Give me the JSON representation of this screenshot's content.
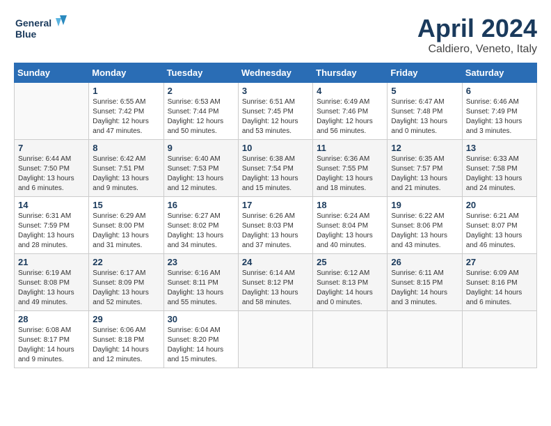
{
  "header": {
    "logo_line1": "General",
    "logo_line2": "Blue",
    "title": "April 2024",
    "location": "Caldiero, Veneto, Italy"
  },
  "weekdays": [
    "Sunday",
    "Monday",
    "Tuesday",
    "Wednesday",
    "Thursday",
    "Friday",
    "Saturday"
  ],
  "weeks": [
    [
      {
        "day": "",
        "sunrise": "",
        "sunset": "",
        "daylight": ""
      },
      {
        "day": "1",
        "sunrise": "6:55 AM",
        "sunset": "7:42 PM",
        "daylight": "12 hours and 47 minutes."
      },
      {
        "day": "2",
        "sunrise": "6:53 AM",
        "sunset": "7:44 PM",
        "daylight": "12 hours and 50 minutes."
      },
      {
        "day": "3",
        "sunrise": "6:51 AM",
        "sunset": "7:45 PM",
        "daylight": "12 hours and 53 minutes."
      },
      {
        "day": "4",
        "sunrise": "6:49 AM",
        "sunset": "7:46 PM",
        "daylight": "12 hours and 56 minutes."
      },
      {
        "day": "5",
        "sunrise": "6:47 AM",
        "sunset": "7:48 PM",
        "daylight": "13 hours and 0 minutes."
      },
      {
        "day": "6",
        "sunrise": "6:46 AM",
        "sunset": "7:49 PM",
        "daylight": "13 hours and 3 minutes."
      }
    ],
    [
      {
        "day": "7",
        "sunrise": "6:44 AM",
        "sunset": "7:50 PM",
        "daylight": "13 hours and 6 minutes."
      },
      {
        "day": "8",
        "sunrise": "6:42 AM",
        "sunset": "7:51 PM",
        "daylight": "13 hours and 9 minutes."
      },
      {
        "day": "9",
        "sunrise": "6:40 AM",
        "sunset": "7:53 PM",
        "daylight": "13 hours and 12 minutes."
      },
      {
        "day": "10",
        "sunrise": "6:38 AM",
        "sunset": "7:54 PM",
        "daylight": "13 hours and 15 minutes."
      },
      {
        "day": "11",
        "sunrise": "6:36 AM",
        "sunset": "7:55 PM",
        "daylight": "13 hours and 18 minutes."
      },
      {
        "day": "12",
        "sunrise": "6:35 AM",
        "sunset": "7:57 PM",
        "daylight": "13 hours and 21 minutes."
      },
      {
        "day": "13",
        "sunrise": "6:33 AM",
        "sunset": "7:58 PM",
        "daylight": "13 hours and 24 minutes."
      }
    ],
    [
      {
        "day": "14",
        "sunrise": "6:31 AM",
        "sunset": "7:59 PM",
        "daylight": "13 hours and 28 minutes."
      },
      {
        "day": "15",
        "sunrise": "6:29 AM",
        "sunset": "8:00 PM",
        "daylight": "13 hours and 31 minutes."
      },
      {
        "day": "16",
        "sunrise": "6:27 AM",
        "sunset": "8:02 PM",
        "daylight": "13 hours and 34 minutes."
      },
      {
        "day": "17",
        "sunrise": "6:26 AM",
        "sunset": "8:03 PM",
        "daylight": "13 hours and 37 minutes."
      },
      {
        "day": "18",
        "sunrise": "6:24 AM",
        "sunset": "8:04 PM",
        "daylight": "13 hours and 40 minutes."
      },
      {
        "day": "19",
        "sunrise": "6:22 AM",
        "sunset": "8:06 PM",
        "daylight": "13 hours and 43 minutes."
      },
      {
        "day": "20",
        "sunrise": "6:21 AM",
        "sunset": "8:07 PM",
        "daylight": "13 hours and 46 minutes."
      }
    ],
    [
      {
        "day": "21",
        "sunrise": "6:19 AM",
        "sunset": "8:08 PM",
        "daylight": "13 hours and 49 minutes."
      },
      {
        "day": "22",
        "sunrise": "6:17 AM",
        "sunset": "8:09 PM",
        "daylight": "13 hours and 52 minutes."
      },
      {
        "day": "23",
        "sunrise": "6:16 AM",
        "sunset": "8:11 PM",
        "daylight": "13 hours and 55 minutes."
      },
      {
        "day": "24",
        "sunrise": "6:14 AM",
        "sunset": "8:12 PM",
        "daylight": "13 hours and 58 minutes."
      },
      {
        "day": "25",
        "sunrise": "6:12 AM",
        "sunset": "8:13 PM",
        "daylight": "14 hours and 0 minutes."
      },
      {
        "day": "26",
        "sunrise": "6:11 AM",
        "sunset": "8:15 PM",
        "daylight": "14 hours and 3 minutes."
      },
      {
        "day": "27",
        "sunrise": "6:09 AM",
        "sunset": "8:16 PM",
        "daylight": "14 hours and 6 minutes."
      }
    ],
    [
      {
        "day": "28",
        "sunrise": "6:08 AM",
        "sunset": "8:17 PM",
        "daylight": "14 hours and 9 minutes."
      },
      {
        "day": "29",
        "sunrise": "6:06 AM",
        "sunset": "8:18 PM",
        "daylight": "14 hours and 12 minutes."
      },
      {
        "day": "30",
        "sunrise": "6:04 AM",
        "sunset": "8:20 PM",
        "daylight": "14 hours and 15 minutes."
      },
      {
        "day": "",
        "sunrise": "",
        "sunset": "",
        "daylight": ""
      },
      {
        "day": "",
        "sunrise": "",
        "sunset": "",
        "daylight": ""
      },
      {
        "day": "",
        "sunrise": "",
        "sunset": "",
        "daylight": ""
      },
      {
        "day": "",
        "sunrise": "",
        "sunset": "",
        "daylight": ""
      }
    ]
  ],
  "labels": {
    "sunrise": "Sunrise:",
    "sunset": "Sunset:",
    "daylight": "Daylight:"
  }
}
